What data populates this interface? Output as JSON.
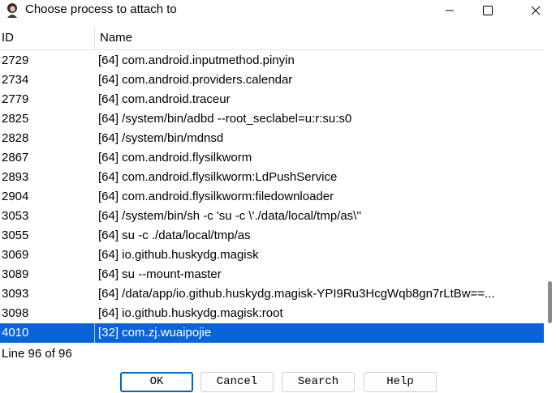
{
  "window": {
    "title": "Choose process to attach to",
    "icon": "app-icon",
    "controls": [
      "minimize-icon",
      "maximize-icon",
      "close-icon"
    ]
  },
  "table": {
    "columns": [
      "ID",
      "Name"
    ],
    "rows": [
      {
        "id": "2729",
        "name": "[64] com.android.inputmethod.pinyin"
      },
      {
        "id": "2734",
        "name": "[64] com.android.providers.calendar"
      },
      {
        "id": "2779",
        "name": "[64] com.android.traceur"
      },
      {
        "id": "2825",
        "name": "[64] /system/bin/adbd --root_seclabel=u:r:su:s0"
      },
      {
        "id": "2828",
        "name": "[64] /system/bin/mdnsd"
      },
      {
        "id": "2867",
        "name": "[64] com.android.flysilkworm"
      },
      {
        "id": "2893",
        "name": "[64] com.android.flysilkworm:LdPushService"
      },
      {
        "id": "2904",
        "name": "[64] com.android.flysilkworm:filedownloader"
      },
      {
        "id": "3053",
        "name": "[64] /system/bin/sh -c 'su -c \\'./data/local/tmp/as\\''"
      },
      {
        "id": "3055",
        "name": "[64] su -c ./data/local/tmp/as"
      },
      {
        "id": "3069",
        "name": "[64] io.github.huskydg.magisk"
      },
      {
        "id": "3089",
        "name": "[64] su --mount-master"
      },
      {
        "id": "3093",
        "name": "[64] /data/app/io.github.huskydg.magisk-YPI9Ru3HcgWqb8gn7rLtBw==..."
      },
      {
        "id": "3098",
        "name": "[64] io.github.huskydg.magisk:root"
      },
      {
        "id": "4010",
        "name": "[32] com.zj.wuaipojie",
        "selected": true
      }
    ]
  },
  "status": "Line 96 of 96",
  "buttons": {
    "ok": "OK",
    "cancel": "Cancel",
    "search": "Search",
    "help": "Help"
  },
  "colors": {
    "selection": "#0a64d8",
    "default_button_border": "#0067c0"
  }
}
